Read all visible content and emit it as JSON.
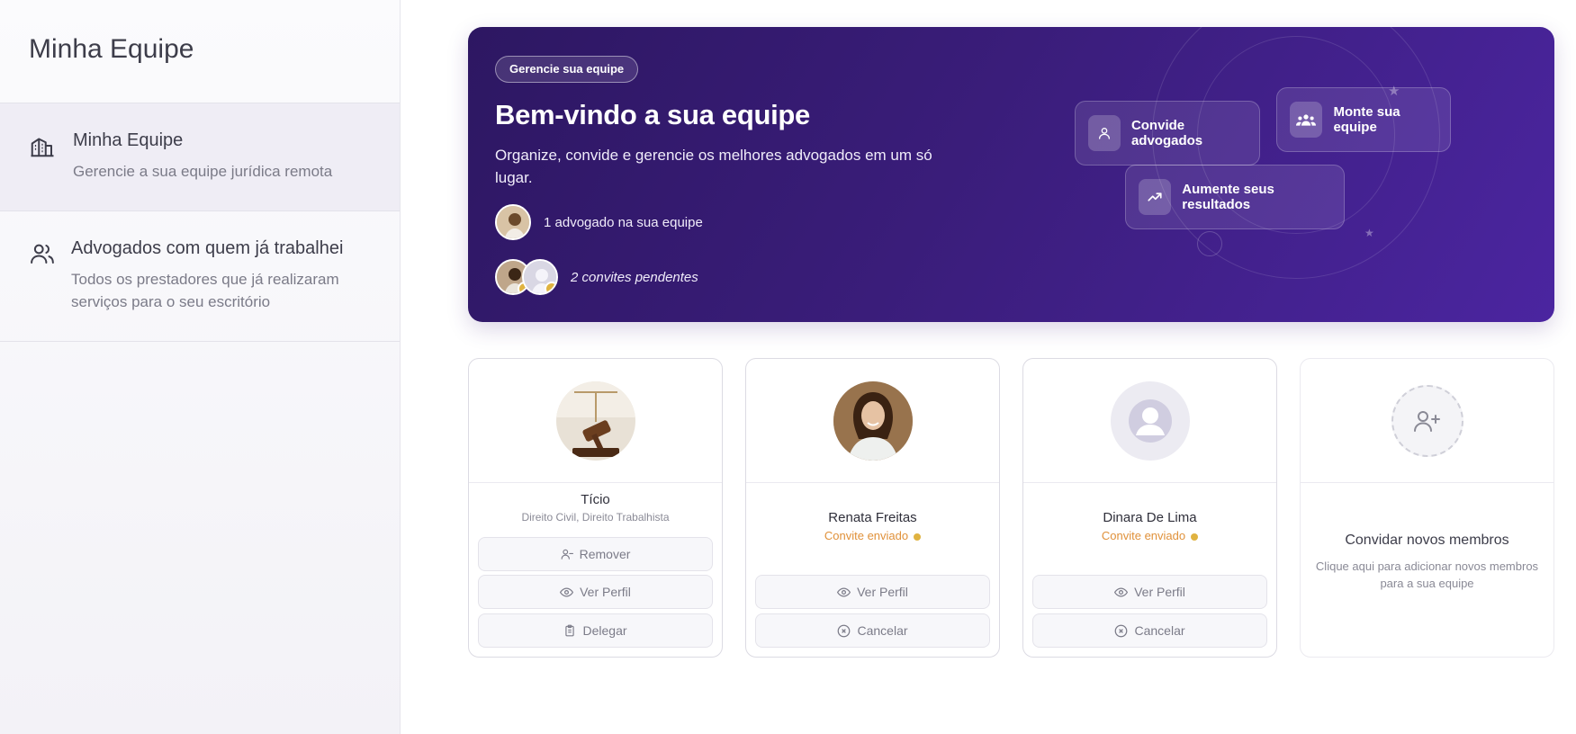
{
  "sidebar": {
    "title": "Minha Equipe",
    "items": [
      {
        "label": "Minha Equipe",
        "sub": "Gerencie a sua equipe jurídica remota",
        "icon": "building-icon"
      },
      {
        "label": "Advogados com quem já trabalhei",
        "sub": "Todos os prestadores que já realizaram serviços para o seu escritório",
        "icon": "users-icon"
      }
    ]
  },
  "hero": {
    "badge": "Gerencie sua equipe",
    "title": "Bem-vindo a sua equipe",
    "description": "Organize, convide e gerencie os melhores advogados em um só lugar.",
    "team_count": "1 advogado na sua equipe",
    "pending": "2 convites pendentes",
    "chips": [
      {
        "label": "Convide advogados",
        "icon": "user-icon"
      },
      {
        "label": "Monte sua equipe",
        "icon": "team-icon"
      },
      {
        "label": "Aumente seus resultados",
        "icon": "trending-up-icon"
      }
    ]
  },
  "cards": [
    {
      "name": "Tício",
      "spec": "Direito Civil, Direito Trabalhista",
      "buttons": [
        "Remover",
        "Ver Perfil",
        "Delegar"
      ]
    },
    {
      "name": "Renata Freitas",
      "status": "Convite enviado",
      "buttons": [
        "Ver Perfil",
        "Cancelar"
      ]
    },
    {
      "name": "Dinara De Lima",
      "status": "Convite enviado",
      "buttons": [
        "Ver Perfil",
        "Cancelar"
      ]
    }
  ],
  "invite": {
    "title": "Convidar novos membros",
    "sub": "Clique aqui para adicionar novos membros para a sua equipe"
  },
  "colors": {
    "accent": "#3a1d7a",
    "pending": "#e0b341",
    "status_text": "#e0913a"
  }
}
